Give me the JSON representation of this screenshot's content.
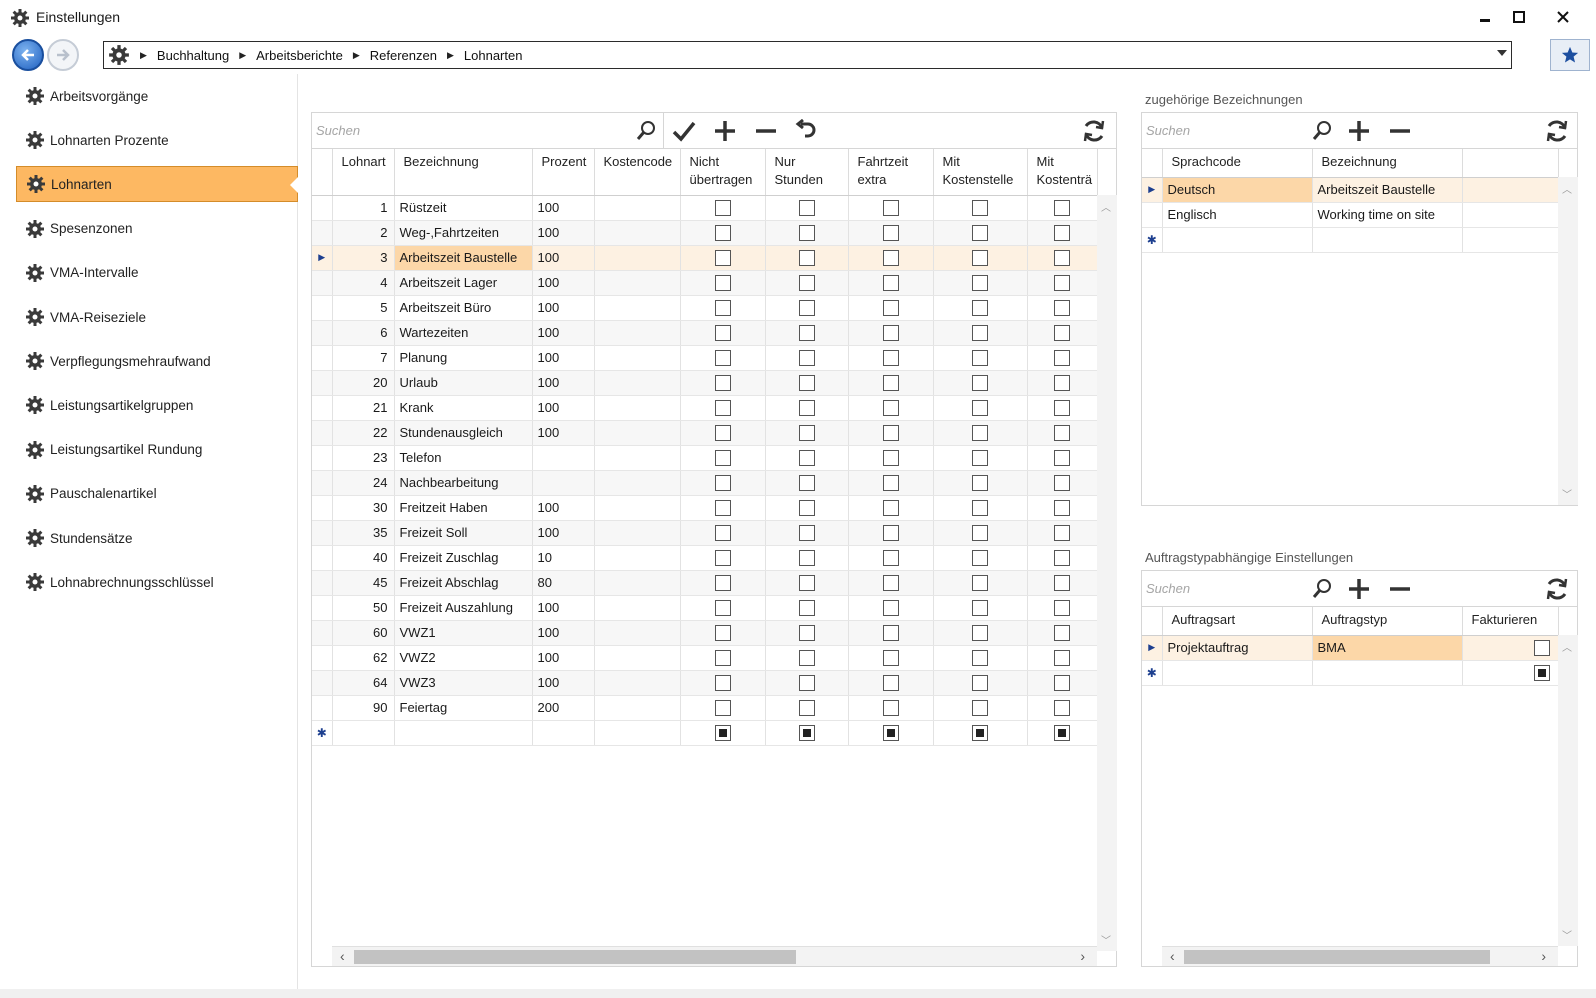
{
  "window": {
    "title": "Einstellungen",
    "minimize": "▬",
    "maximize": "☐",
    "close": "✕"
  },
  "nav": {
    "back_icon": "arrow-left-icon",
    "forward_icon": "arrow-right-icon",
    "breadcrumb": [
      "Buchhaltung",
      "Arbeitsberichte",
      "Referenzen",
      "Lohnarten"
    ],
    "favorite_icon": "star-icon"
  },
  "sidebar": {
    "items": [
      {
        "label": "Arbeitsvorgänge",
        "active": false
      },
      {
        "label": "Lohnarten Prozente",
        "active": false
      },
      {
        "label": "Lohnarten",
        "active": true
      },
      {
        "label": "Spesenzonen",
        "active": false
      },
      {
        "label": "VMA-Intervalle",
        "active": false
      },
      {
        "label": "VMA-Reiseziele",
        "active": false
      },
      {
        "label": "Verpflegungsmehraufwand",
        "active": false
      },
      {
        "label": "Leistungsartikelgruppen",
        "active": false
      },
      {
        "label": "Leistungsartikel Rundung",
        "active": false
      },
      {
        "label": "Pauschalenartikel",
        "active": false
      },
      {
        "label": "Stundensätze",
        "active": false
      },
      {
        "label": "Lohnabrechnungsschlüssel",
        "active": false
      }
    ]
  },
  "main_grid": {
    "search_placeholder": "Suchen",
    "columns": [
      "Lohnart",
      "Bezeichnung",
      "Prozent",
      "Kostencode",
      "Nicht übertragen",
      "Nur Stunden",
      "Fahrtzeit extra",
      "Mit Kostenstelle",
      "Mit Kostenträ"
    ],
    "rows": [
      {
        "lohnart": "1",
        "bezeichnung": "Rüstzeit",
        "prozent": "100"
      },
      {
        "lohnart": "2",
        "bezeichnung": "Weg-,Fahrtzeiten",
        "prozent": "100"
      },
      {
        "lohnart": "3",
        "bezeichnung": "Arbeitszeit Baustelle",
        "prozent": "100",
        "selected": true
      },
      {
        "lohnart": "4",
        "bezeichnung": "Arbeitszeit Lager",
        "prozent": "100"
      },
      {
        "lohnart": "5",
        "bezeichnung": "Arbeitszeit Büro",
        "prozent": "100"
      },
      {
        "lohnart": "6",
        "bezeichnung": "Wartezeiten",
        "prozent": "100"
      },
      {
        "lohnart": "7",
        "bezeichnung": "Planung",
        "prozent": "100"
      },
      {
        "lohnart": "20",
        "bezeichnung": "Urlaub",
        "prozent": "100"
      },
      {
        "lohnart": "21",
        "bezeichnung": "Krank",
        "prozent": "100"
      },
      {
        "lohnart": "22",
        "bezeichnung": "Stundenausgleich",
        "prozent": "100"
      },
      {
        "lohnart": "23",
        "bezeichnung": "Telefon",
        "prozent": ""
      },
      {
        "lohnart": "24",
        "bezeichnung": "Nachbearbeitung",
        "prozent": ""
      },
      {
        "lohnart": "30",
        "bezeichnung": "Freitzeit Haben",
        "prozent": "100"
      },
      {
        "lohnart": "35",
        "bezeichnung": "Freizeit Soll",
        "prozent": "100"
      },
      {
        "lohnart": "40",
        "bezeichnung": "Freizeit Zuschlag",
        "prozent": "10"
      },
      {
        "lohnart": "45",
        "bezeichnung": "Freizeit Abschlag",
        "prozent": "80"
      },
      {
        "lohnart": "50",
        "bezeichnung": "Freizeit Auszahlung",
        "prozent": "100"
      },
      {
        "lohnart": "60",
        "bezeichnung": "VWZ1",
        "prozent": "100"
      },
      {
        "lohnart": "62",
        "bezeichnung": "VWZ2",
        "prozent": "100"
      },
      {
        "lohnart": "64",
        "bezeichnung": "VWZ3",
        "prozent": "100"
      },
      {
        "lohnart": "90",
        "bezeichnung": "Feiertag",
        "prozent": "200"
      }
    ]
  },
  "bezeichnungen": {
    "section_title": "zugehörige Bezeichnungen",
    "search_placeholder": "Suchen",
    "columns": [
      "Sprachcode",
      "Bezeichnung"
    ],
    "rows": [
      {
        "sprachcode": "Deutsch",
        "bezeichnung": "Arbeitszeit Baustelle",
        "selected": true
      },
      {
        "sprachcode": "Englisch",
        "bezeichnung": "Working time on site"
      }
    ]
  },
  "auftragstyp": {
    "section_title": "Auftragstypabhängige Einstellungen",
    "search_placeholder": "Suchen",
    "columns": [
      "Auftragsart",
      "Auftragstyp",
      "Fakturieren"
    ],
    "rows": [
      {
        "auftragsart": "Projektauftrag",
        "auftragstyp": "BMA",
        "fakturieren": false,
        "selected": true
      }
    ]
  },
  "colors": {
    "active_item": "#fdb862",
    "selected_row": "#fdf1e2",
    "selected_cell": "#fcd7a8",
    "nav_blue": "#1e5fbf"
  }
}
